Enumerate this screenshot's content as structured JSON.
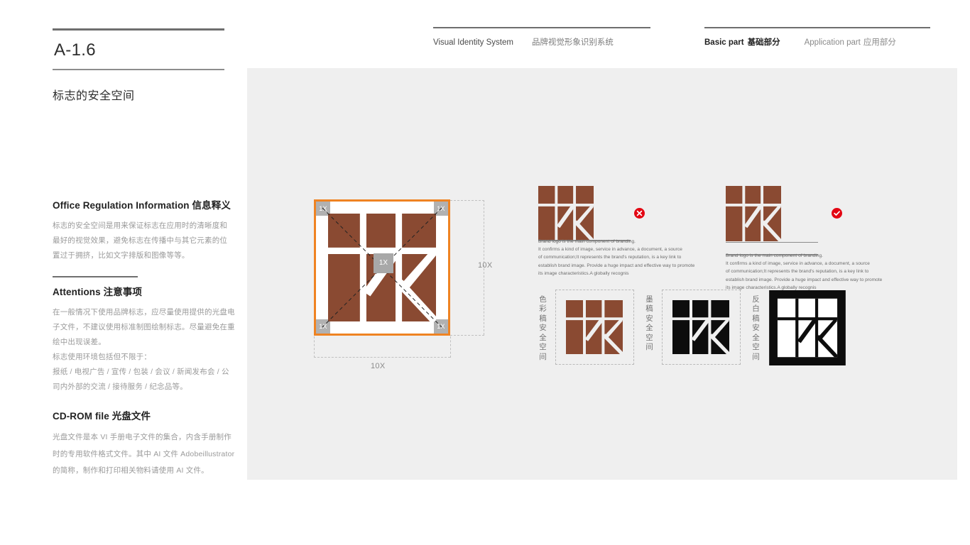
{
  "page": {
    "code": "A-1.6",
    "subtitle": "标志的安全空间"
  },
  "header": {
    "left": {
      "en": "Visual Identity System",
      "cn": "品牌视觉形象识别系统"
    },
    "tabs": [
      {
        "en": "Basic part",
        "cn": "基础部分",
        "active": true
      },
      {
        "en": "Application part",
        "cn": "应用部分",
        "active": false
      }
    ]
  },
  "sections": [
    {
      "id": "office",
      "head_en": "Office Regulation Information",
      "head_cn": "信息释义",
      "lines": [
        "标志的安全空间是用来保证标志在应用时的清晰度和",
        "最好的视觉效果，避免标志在传播中与其它元素的位",
        "置过于拥挤，比如文字排版和图像等等。"
      ]
    },
    {
      "id": "attentions",
      "head_en": "Attentions",
      "head_cn": "注意事项",
      "lines": [
        "在一般情况下使用品牌标志，应尽量使用提供的光盘电",
        "子文件，不建议使用标准制图绘制标志。尽量避免在重",
        "绘中出现误差。",
        "标志使用环境包括但不限于：",
        "报纸 / 电视广告 / 宣传 / 包装 / 会议 / 新闻发布会 / 公",
        "司内外部的交流 / 接待服务 / 纪念品等。"
      ]
    },
    {
      "id": "cdrom",
      "head_en": "CD-ROM file",
      "head_cn": "光盘文件",
      "lines": [
        "光盘文件是本 VI 手册电子文件的集合，内含手册制作",
        "时的专用软件格式文件。其中 AI 文件 Adobeillustrator",
        "的简称，制作和打印相关物料请使用 AI 文件。"
      ]
    }
  ],
  "figure": {
    "corner_unit": "1X",
    "center_unit": "1X",
    "width_label": "10X",
    "height_label": "10X",
    "safe_frame_color": "#ef8322",
    "logo_color": "#8a4a32"
  },
  "examples": [
    {
      "id": "incorrect",
      "mark": "cross-icon",
      "mark_color": "#e30613",
      "body": [
        "Brand logo is the main component of branding.",
        "It confirms a kind of image, service in advance, a document, a source",
        "of communication;It represents the brand's reputation, is a key link to",
        "establish brand image. Provide a huge impact and effective way to promote",
        "its image characteristics.A globally recognis"
      ]
    },
    {
      "id": "correct",
      "mark": "check-icon",
      "mark_color": "#e30613",
      "body": [
        "Brand logo is the main component of branding.",
        "It confirms a kind of image, service in advance, a document, a source",
        "of communication;It represents the brand's reputation, is a key link to",
        "establish brand image. Provide a huge impact and effective way to promote",
        "its image characteristics.A globally recognis"
      ]
    }
  ],
  "variants": [
    {
      "id": "color",
      "label": "色彩稿安全空间",
      "fill": "#8a4a32",
      "bg": "transparent",
      "gap": "#efefef"
    },
    {
      "id": "ink",
      "label": "墨稿安全空间",
      "fill": "#0d0d0d",
      "bg": "transparent",
      "gap": "#efefef"
    },
    {
      "id": "reverse",
      "label": "反白稿安全空间",
      "fill": "#ffffff",
      "bg": "#0d0d0d",
      "gap": "#0d0d0d"
    }
  ]
}
